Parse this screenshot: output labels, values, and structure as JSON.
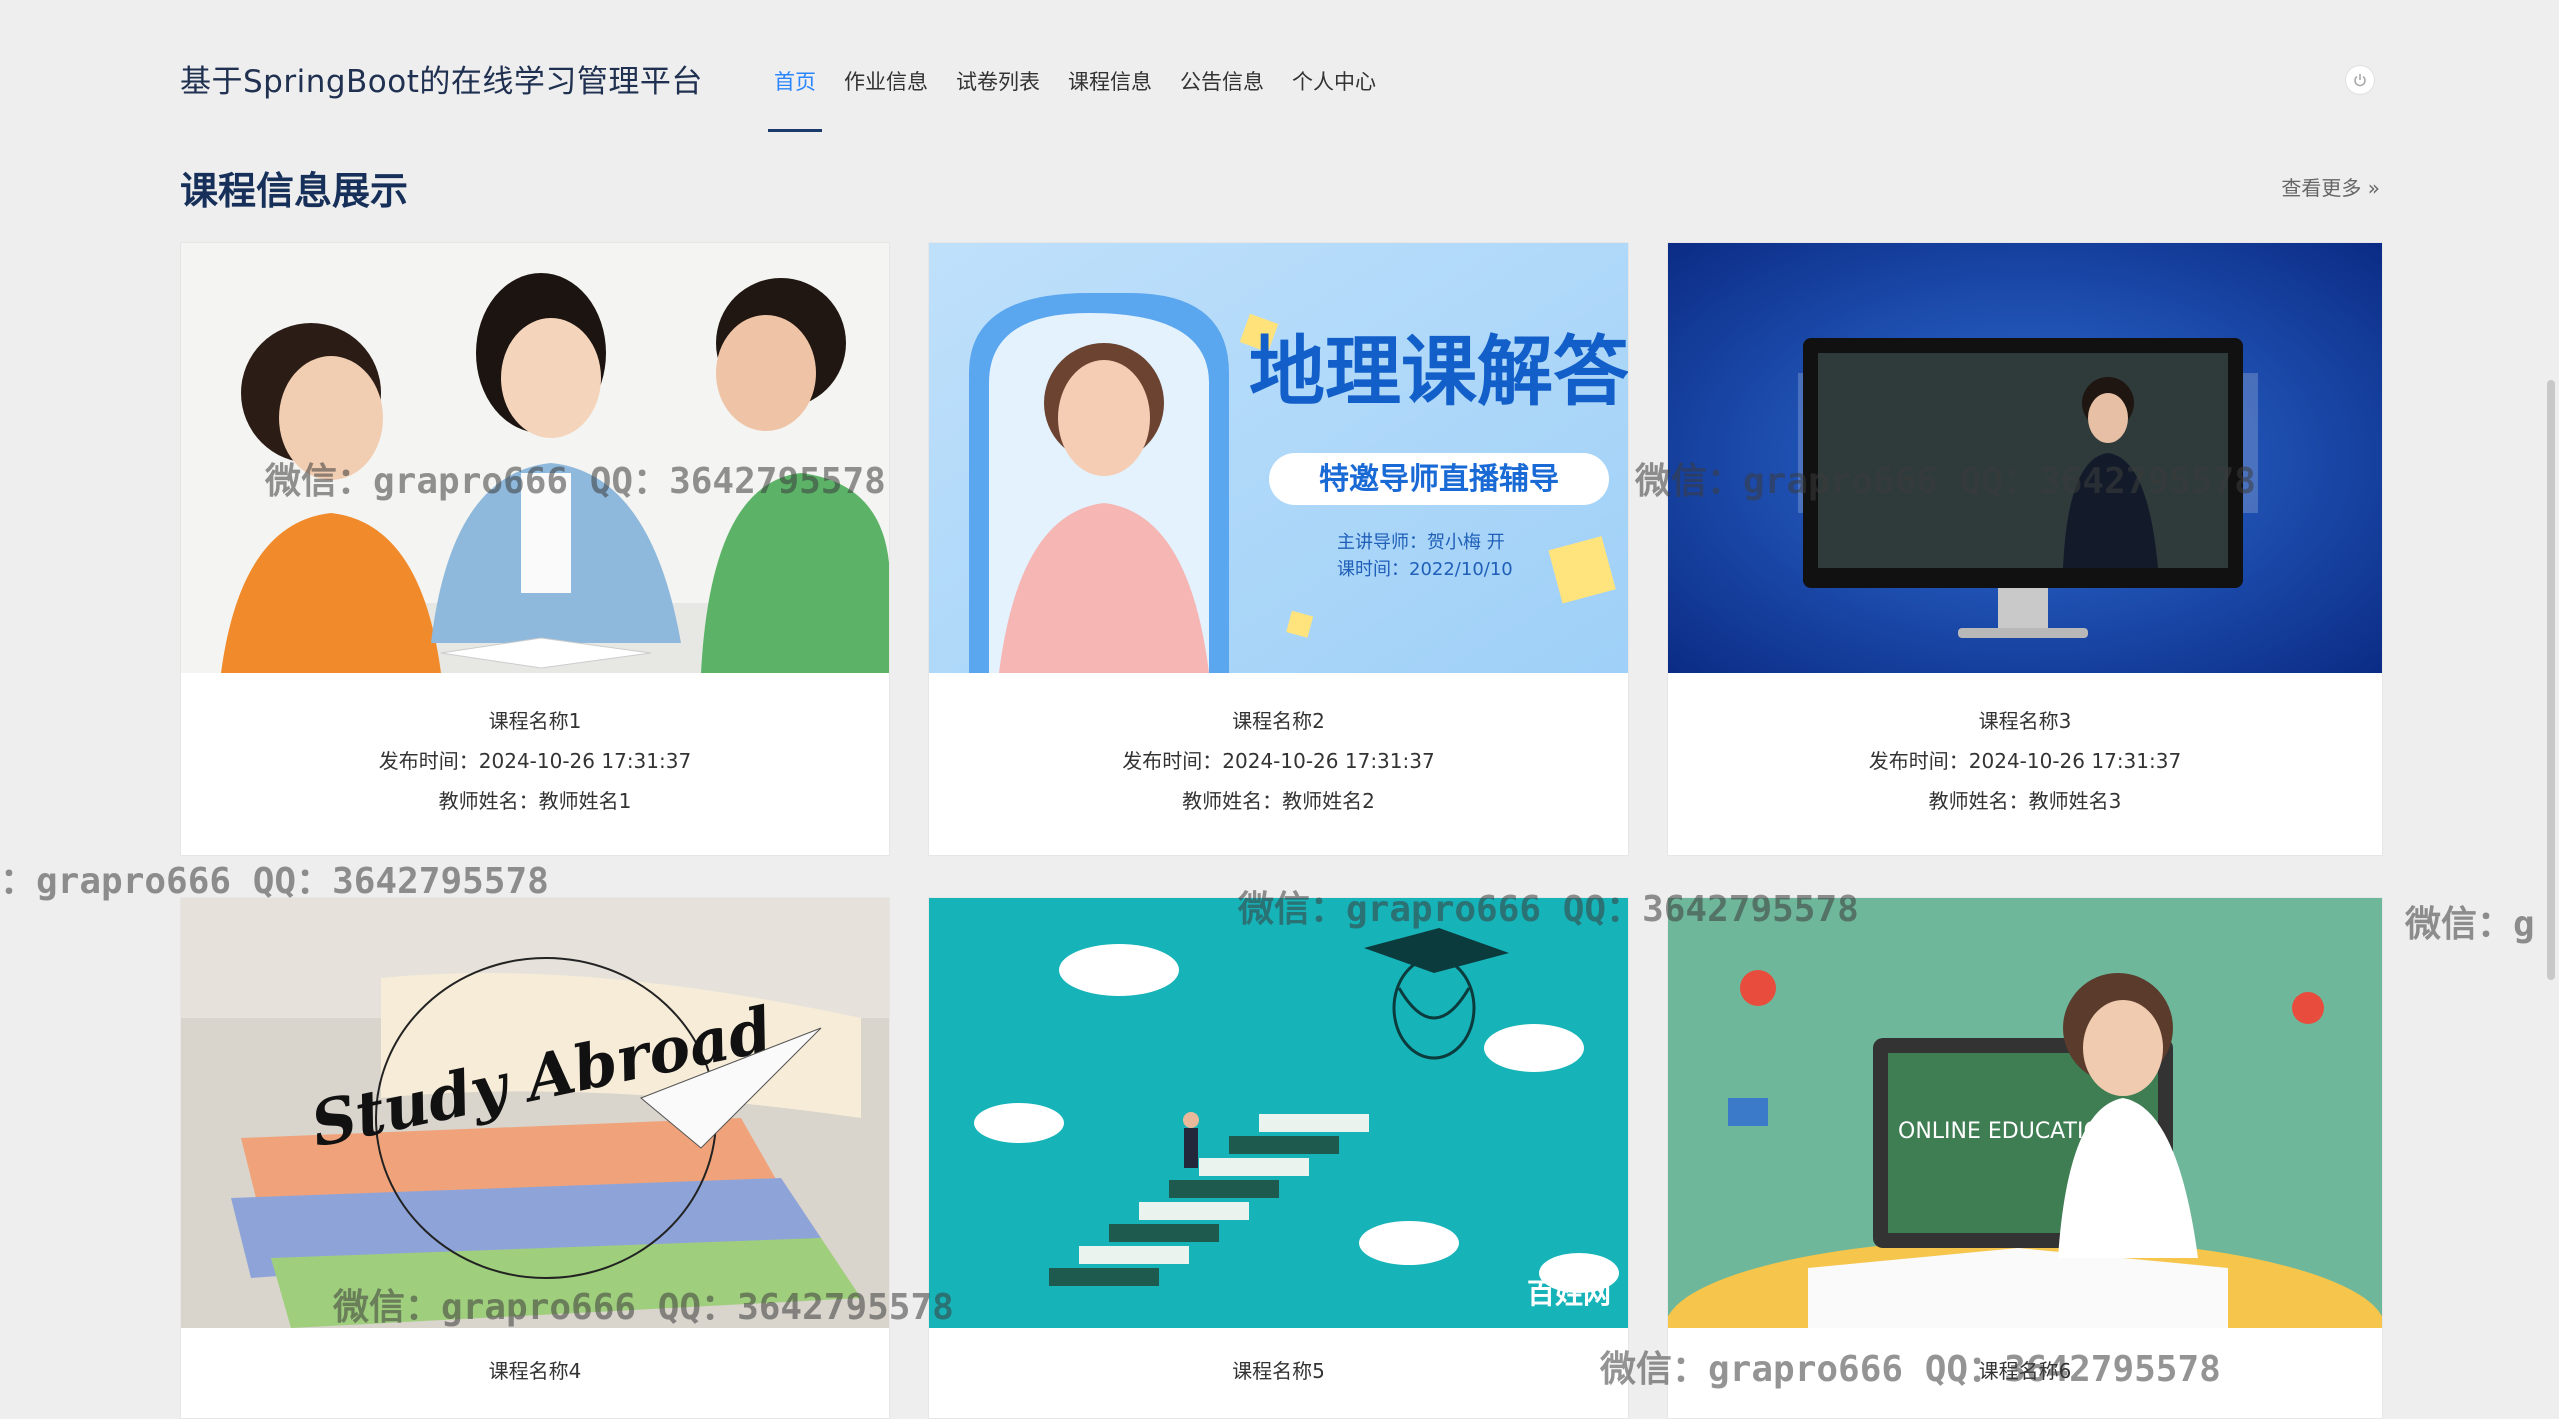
{
  "header": {
    "site_title": "基于SpringBoot的在线学习管理平台",
    "nav": [
      {
        "label": "首页",
        "active": true
      },
      {
        "label": "作业信息",
        "active": false
      },
      {
        "label": "试卷列表",
        "active": false
      },
      {
        "label": "课程信息",
        "active": false
      },
      {
        "label": "公告信息",
        "active": false
      },
      {
        "label": "个人中心",
        "active": false
      }
    ],
    "power_icon": "power-icon"
  },
  "section": {
    "title": "课程信息展示",
    "more": "查看更多",
    "more_icon": "double-chevron-right-icon"
  },
  "courses": [
    {
      "name": "课程名称1",
      "publish": "发布时间：2024-10-26 17:31:37",
      "teacher": "教师姓名：教师姓名1",
      "thumb_text": ""
    },
    {
      "name": "课程名称2",
      "publish": "发布时间：2024-10-26 17:31:37",
      "teacher": "教师姓名：教师姓名2",
      "thumb_text": "地理课解答",
      "thumb_sub": "特邀导师直播辅导",
      "thumb_line1": "主讲导师：贺小梅 开",
      "thumb_line2": "课时间：2022/10/10"
    },
    {
      "name": "课程名称3",
      "publish": "发布时间：2024-10-26 17:31:37",
      "teacher": "教师姓名：教师姓名3",
      "thumb_text": ""
    },
    {
      "name": "课程名称4",
      "publish": "",
      "teacher": "",
      "thumb_text": "Study Abroad"
    },
    {
      "name": "课程名称5",
      "publish": "",
      "teacher": "",
      "thumb_text": "百姓网"
    },
    {
      "name": "课程名称6",
      "publish": "",
      "teacher": "",
      "thumb_text": "ONLINE EDUCATION"
    }
  ],
  "watermarks": [
    "微信：grapro666 QQ：3642795578",
    "微信：grapro666 QQ：3642795578",
    "：grapro666 QQ：3642795578",
    "微信：grapro666 QQ：3642795578",
    "微信：g",
    "微信：grapro666 QQ：3642795578",
    "微信：grapro666 QQ：3642795578"
  ],
  "colors": {
    "accent": "#2a86ff",
    "title": "#17305a",
    "background": "#eeeeee"
  }
}
